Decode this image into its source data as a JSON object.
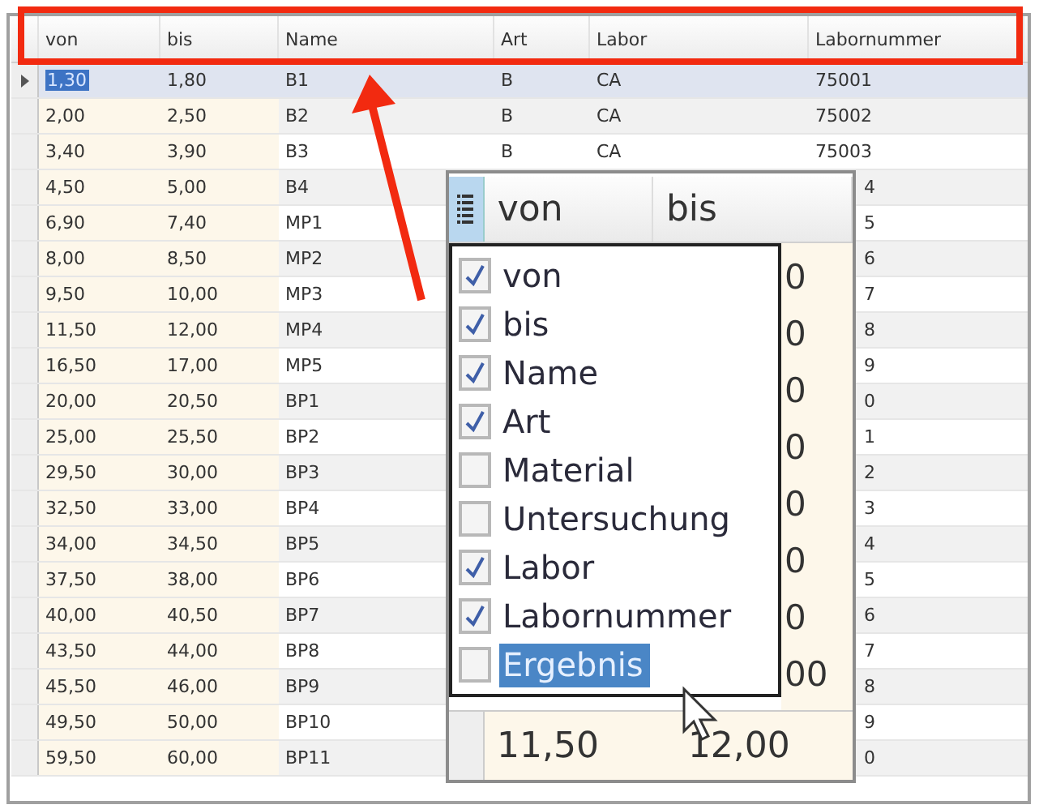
{
  "columns": [
    "von",
    "bis",
    "Name",
    "Art",
    "Labor",
    "Labornummer"
  ],
  "rows": [
    {
      "von": "1,30",
      "bis": "1,80",
      "name": "B1",
      "art": "B",
      "labor": "CA",
      "labornummer": "75001",
      "selected": true,
      "covered": false
    },
    {
      "von": "2,00",
      "bis": "2,50",
      "name": "B2",
      "art": "B",
      "labor": "CA",
      "labornummer": "75002",
      "selected": false,
      "covered": false
    },
    {
      "von": "3,40",
      "bis": "3,90",
      "name": "B3",
      "art": "B",
      "labor": "CA",
      "labornummer": "75003",
      "selected": false,
      "covered": false
    },
    {
      "von": "4,50",
      "bis": "5,00",
      "name": "B4",
      "labornummer": "4",
      "selected": false,
      "covered": true
    },
    {
      "von": "6,90",
      "bis": "7,40",
      "name": "MP1",
      "labornummer": "5",
      "selected": false,
      "covered": true
    },
    {
      "von": "8,00",
      "bis": "8,50",
      "name": "MP2",
      "labornummer": "6",
      "selected": false,
      "covered": true
    },
    {
      "von": "9,50",
      "bis": "10,00",
      "name": "MP3",
      "labornummer": "7",
      "selected": false,
      "covered": true
    },
    {
      "von": "11,50",
      "bis": "12,00",
      "name": "MP4",
      "labornummer": "8",
      "selected": false,
      "covered": true
    },
    {
      "von": "16,50",
      "bis": "17,00",
      "name": "MP5",
      "labornummer": "9",
      "selected": false,
      "covered": true
    },
    {
      "von": "20,00",
      "bis": "20,50",
      "name": "BP1",
      "labornummer": "0",
      "selected": false,
      "covered": true
    },
    {
      "von": "25,00",
      "bis": "25,50",
      "name": "BP2",
      "labornummer": "1",
      "selected": false,
      "covered": true
    },
    {
      "von": "29,50",
      "bis": "30,00",
      "name": "BP3",
      "labornummer": "2",
      "selected": false,
      "covered": true
    },
    {
      "von": "32,50",
      "bis": "33,00",
      "name": "BP4",
      "labornummer": "3",
      "selected": false,
      "covered": true
    },
    {
      "von": "34,00",
      "bis": "34,50",
      "name": "BP5",
      "labornummer": "4",
      "selected": false,
      "covered": true
    },
    {
      "von": "37,50",
      "bis": "38,00",
      "name": "BP6",
      "labornummer": "5",
      "selected": false,
      "covered": true
    },
    {
      "von": "40,00",
      "bis": "40,50",
      "name": "BP7",
      "labornummer": "6",
      "selected": false,
      "covered": true
    },
    {
      "von": "43,50",
      "bis": "44,00",
      "name": "BP8",
      "labornummer": "7",
      "selected": false,
      "covered": true
    },
    {
      "von": "45,50",
      "bis": "46,00",
      "name": "BP9",
      "labornummer": "8",
      "selected": false,
      "covered": true
    },
    {
      "von": "49,50",
      "bis": "50,00",
      "name": "BP10",
      "labornummer": "9",
      "selected": false,
      "covered": true
    },
    {
      "von": "59,50",
      "bis": "60,00",
      "name": "BP11",
      "labornummer": "0",
      "selected": false,
      "covered": true
    }
  ],
  "zoom_inset": {
    "header": [
      "von",
      "bis"
    ],
    "menu": [
      {
        "label": "von",
        "checked": true,
        "selected": false
      },
      {
        "label": "bis",
        "checked": true,
        "selected": false
      },
      {
        "label": "Name",
        "checked": true,
        "selected": false
      },
      {
        "label": "Art",
        "checked": true,
        "selected": false
      },
      {
        "label": "Material",
        "checked": false,
        "selected": false
      },
      {
        "label": "Untersuchung",
        "checked": false,
        "selected": false
      },
      {
        "label": "Labor",
        "checked": true,
        "selected": false
      },
      {
        "label": "Labornummer",
        "checked": true,
        "selected": false
      },
      {
        "label": "Ergebnis",
        "checked": false,
        "selected": true
      }
    ],
    "cell_fragments": [
      "0",
      "0",
      "0",
      "0",
      "0",
      "0",
      "0",
      "00"
    ],
    "last_row": [
      "11,50",
      "12,00"
    ]
  }
}
